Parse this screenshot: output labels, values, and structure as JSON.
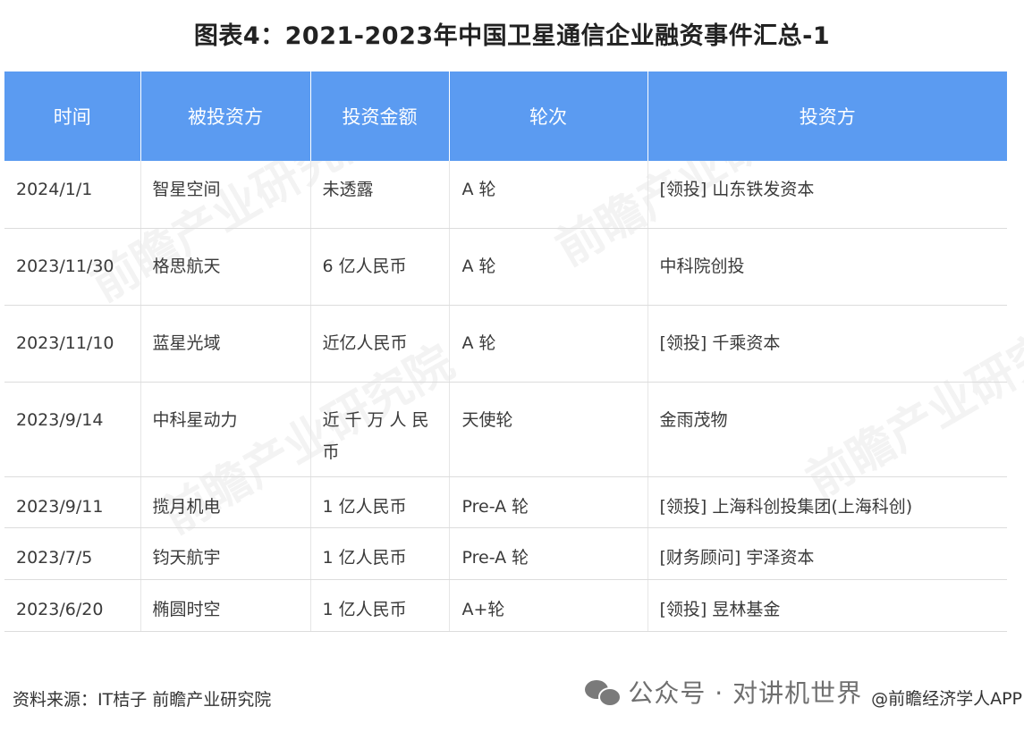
{
  "title": "图表4：2021-2023年中国卫星通信企业融资事件汇总-1",
  "table": {
    "headers": [
      "时间",
      "被投资方",
      "投资金额",
      "轮次",
      "投资方"
    ],
    "rows": [
      {
        "date": "2024/1/1",
        "company": "智星空间",
        "amount": "未透露",
        "round": "A 轮",
        "investor": "[领投] 山东铁发资本"
      },
      {
        "date": "2023/11/30",
        "company": "格思航天",
        "amount": "6 亿人民币",
        "round": "A 轮",
        "investor": "中科院创投"
      },
      {
        "date": "2023/11/10",
        "company": "蓝星光域",
        "amount": "近亿人民币",
        "round": "A 轮",
        "investor": "[领投] 千乘资本"
      },
      {
        "date": "2023/9/14",
        "company": "中科星动力",
        "amount": "近千万人民币",
        "round": "天使轮",
        "investor": "金雨茂物"
      },
      {
        "date": "2023/9/11",
        "company": "揽月机电",
        "amount": "1 亿人民币",
        "round": "Pre-A 轮",
        "investor": "[领投] 上海科创投集团(上海科创)"
      },
      {
        "date": "2023/7/5",
        "company": "钧天航宇",
        "amount": "1 亿人民币",
        "round": "Pre-A 轮",
        "investor": "[财务顾问] 宇泽资本"
      },
      {
        "date": "2023/6/20",
        "company": "椭圆时空",
        "amount": "1 亿人民币",
        "round": "A+轮",
        "investor": "[领投] 昱林基金"
      }
    ]
  },
  "source": "资料来源：IT桔子 前瞻产业研究院",
  "footer": {
    "icon": "wechat-icon",
    "channel": "公众号 · 对讲机世界",
    "app": "@前瞻经济学人APP"
  },
  "watermark": "前瞻产业研究院",
  "colors": {
    "header_bg": "#5b9bf1",
    "header_text": "#ffffff"
  }
}
